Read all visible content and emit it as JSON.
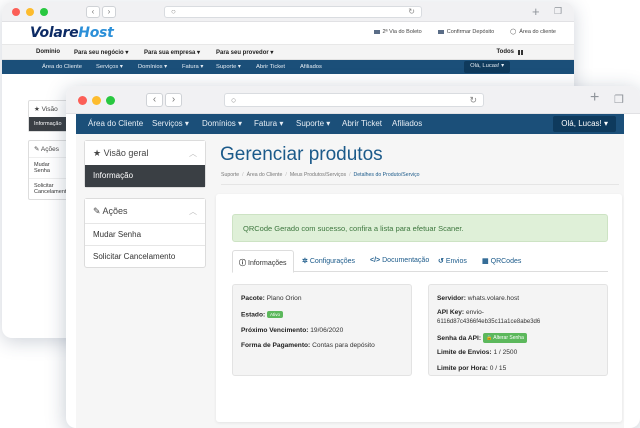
{
  "back_window": {
    "logo_prefix": "V",
    "logo_main": "olare",
    "logo_suffix": "Host",
    "header_links": [
      "2ª Via do Boleto",
      "Confirmar Depósito",
      "Área do cliente"
    ],
    "menu": [
      "Domínio",
      "Para seu negócio ▾",
      "Para sua empresa ▾",
      "Para seu provedor ▾"
    ],
    "todos": "Todos",
    "nav": [
      "Área do Cliente",
      "Serviços ▾",
      "Domínios ▾",
      "Fatura ▾",
      "Suporte ▾",
      "Abrir Ticket",
      "Afiliados"
    ],
    "ola": "Olá, Lucas! ▾",
    "side_title1": "Visão",
    "side_active": "Informação",
    "side_title2": "Ações",
    "side_item1": "Mudar Senha",
    "side_item2": "Solicitar Cancelamento"
  },
  "front_window": {
    "nav": {
      "area": "Área do Cliente",
      "servicos": "Serviços ▾",
      "dominios": "Domínios ▾",
      "fatura": "Fatura ▾",
      "suporte": "Suporte ▾",
      "ticket": "Abrir Ticket",
      "afiliados": "Afiliados",
      "ola": "Olá, Lucas! ▾"
    },
    "sidebar": {
      "overview_title": "Visão geral",
      "overview_item": "Informação",
      "actions_title": "Ações",
      "actions_items": [
        "Mudar Senha",
        "Solicitar Cancelamento"
      ]
    },
    "page_title": "Gerenciar produtos",
    "breadcrumb": [
      "Suporte",
      "Área do Cliente",
      "Meus Produtos/Serviços",
      "Detalhes do Produto/Serviço"
    ],
    "alert": "QRCode Gerado com sucesso, confira a lista para efetuar Scaner.",
    "tabs": [
      {
        "icon": "info-icon",
        "glyph": "ⓘ",
        "label": "Informações"
      },
      {
        "icon": "cogs-icon",
        "glyph": "✲",
        "label": "Configurações"
      },
      {
        "icon": "code-icon",
        "glyph": "</>",
        "label": "Documentação"
      },
      {
        "icon": "history-icon",
        "glyph": "↺",
        "label": "Envios"
      },
      {
        "icon": "qrcode-icon",
        "glyph": "▦",
        "label": "QRCodes"
      }
    ],
    "info_left": {
      "pacote_label": "Pacote:",
      "pacote": "Plano Orion",
      "estado_label": "Estado:",
      "estado": "Ativo",
      "vencimento_label": "Próximo Vencimento:",
      "vencimento": "19/06/2020",
      "pagamento_label": "Forma de Pagamento:",
      "pagamento": "Contas para depósito"
    },
    "info_right": {
      "servidor_label": "Servidor:",
      "servidor": "whats.volare.host",
      "apikey_label": "API Key:",
      "apikey_1": "envio-",
      "apikey_2": "6116d87c4366f4eb35c11a1ce8abe3d6",
      "senha_label": "Senha da API:",
      "senha_btn": "🔒 Alterar Senha",
      "limite_envios_label": "Limite de Envios:",
      "limite_envios": "1 / 2500",
      "limite_hora_label": "Limite por Hora:",
      "limite_hora": "0 / 15"
    }
  },
  "colors": {
    "nav_blue": "#1b4f79",
    "title_blue": "#1b5a8a",
    "alert_bg": "#dff0d8",
    "badge_green": "#5cb85c"
  }
}
